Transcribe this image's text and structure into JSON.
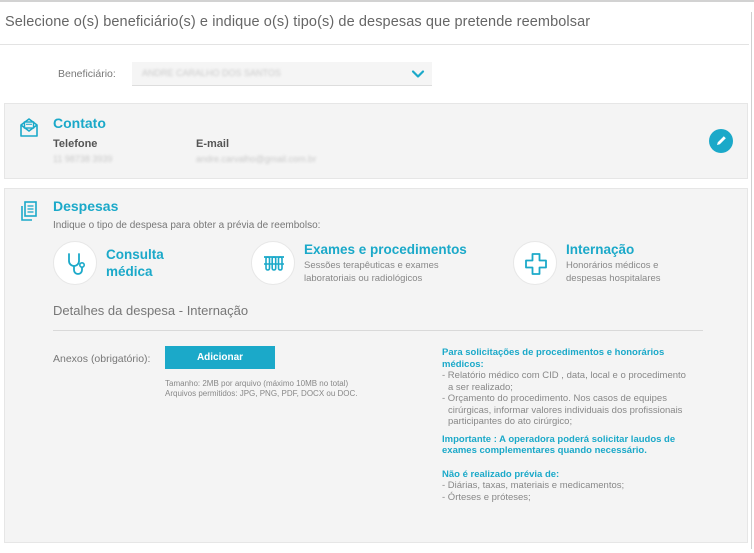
{
  "page": {
    "title": "Selecione o(s) beneficiário(s) e indique o(s) tipo(s) de despesas que pretende reembolsar"
  },
  "beneficiary": {
    "label": "Beneficiário:",
    "value": "ANDRE CARALHO DOS SANTOS"
  },
  "contact": {
    "title": "Contato",
    "phone_label": "Telefone",
    "phone_value": "11 98738 3939",
    "email_label": "E-mail",
    "email_value": "andre.carvalho@gmail.com.br"
  },
  "expenses": {
    "title": "Despesas",
    "subtitle": "Indique o tipo de despesa para obter a prévia de reembolso:",
    "options": [
      {
        "title_line1": "Consulta",
        "title_line2": "médica",
        "icon": "stethoscope-icon"
      },
      {
        "title": "Exames e procedimentos",
        "desc_line1": "Sessões terapêuticas e exames",
        "desc_line2": "laboratoriais ou radiológicos",
        "icon": "test-tubes-icon"
      },
      {
        "title": "Internação",
        "desc_line1": "Honorários médicos e",
        "desc_line2": "despesas hospitalares",
        "icon": "medical-cross-icon"
      }
    ]
  },
  "details": {
    "title": "Detalhes da despesa - Internação",
    "attachments_label": "Anexos (obrigatório):",
    "add_button": "Adicionar",
    "file_size": "Tamanho: 2MB por arquivo (máximo 10MB no total)",
    "file_types": "Arquivos permitidos: JPG, PNG, PDF, DOCX ou DOC."
  },
  "info": {
    "head1_line1": "Para solicitações de procedimentos e honorários",
    "head1_line2": "médicos:",
    "item1_line1": "- Relatório médico com CID , data, local e o procedimento",
    "item1_line2": "a ser realizado;",
    "item2_line1": "- Orçamento do procedimento. Nos casos de equipes",
    "item2_line2": "cirúrgicas, informar valores individuais dos profissionais",
    "item2_line3": "participantes do ato cirúrgico;",
    "important_line1": "Importante : A operadora poderá solicitar laudos de",
    "important_line2": "exames complementares quando necessário.",
    "head2": "Não é realizado prévia de:",
    "item3": "- Diárias, taxas, materiais e medicamentos;",
    "item4": "- Órteses e próteses;"
  },
  "colors": {
    "accent": "#1ba9c9",
    "card_bg": "#f4f4f4"
  }
}
